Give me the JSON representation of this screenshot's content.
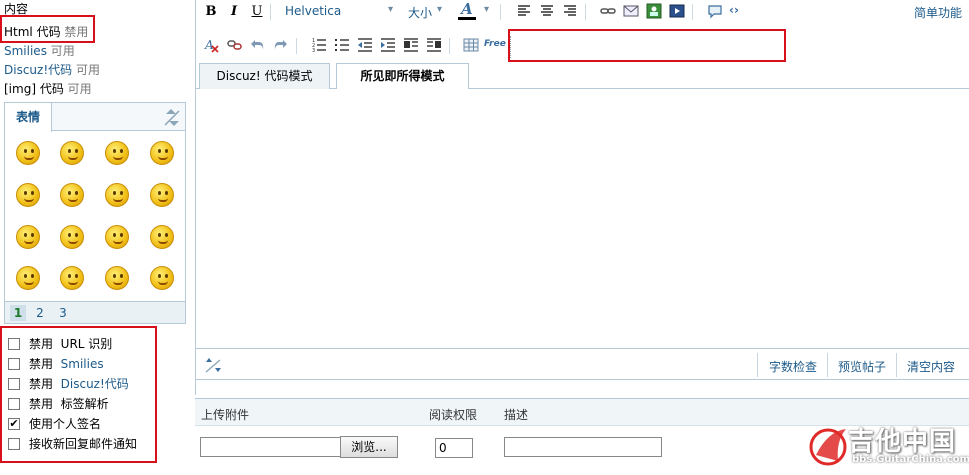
{
  "left": {
    "content_label": "内容",
    "html_code": {
      "name": "Html 代码",
      "status": "禁用"
    },
    "smilies": {
      "name": "Smilies",
      "status": "可用"
    },
    "discuz_code": {
      "name": "Discuz!代码",
      "status": "可用"
    },
    "img_code": {
      "name": "[img] 代码",
      "status": "可用"
    },
    "smiley_tab": "表情",
    "pages": [
      "1",
      "2",
      "3"
    ],
    "active_page": "1",
    "options": [
      {
        "label_prefix": "禁用",
        "label": "URL 识别",
        "checked": false,
        "highlight": false
      },
      {
        "label_prefix": "禁用",
        "label": "Smilies",
        "checked": false,
        "highlight": true
      },
      {
        "label_prefix": "禁用",
        "label": "Discuz!代码",
        "checked": false,
        "highlight": true
      },
      {
        "label_prefix": "禁用",
        "label": "标签解析",
        "checked": false,
        "highlight": false
      },
      {
        "label_prefix": "",
        "label": "使用个人签名",
        "checked": true,
        "highlight": false
      },
      {
        "label_prefix": "",
        "label": "接收新回复邮件通知",
        "checked": false,
        "highlight": false
      }
    ]
  },
  "toolbar": {
    "bold": "B",
    "italic": "I",
    "underline": "U",
    "font": "Helvetica",
    "size": "大小",
    "font_color": "A",
    "simple_mode": "简单功能",
    "free_label": "Free"
  },
  "editor": {
    "tabs": [
      {
        "label": "Discuz! 代码模式",
        "active": false
      },
      {
        "label": "所见即所得模式",
        "active": true
      }
    ],
    "bottom_links": [
      "字数检查",
      "预览帖子",
      "清空内容"
    ]
  },
  "attachments": {
    "col_upload": "上传附件",
    "col_permission": "阅读权限",
    "col_desc": "描述",
    "browse_button": "浏览...",
    "permission_value": "0"
  },
  "watermark": {
    "cn": "吉他中国",
    "url": "bbs.GuitarChina.com"
  },
  "colors": {
    "link_blue": "#1c5a8a",
    "highlight_red": "#d8101a",
    "border_blue": "#b5c9d6"
  }
}
